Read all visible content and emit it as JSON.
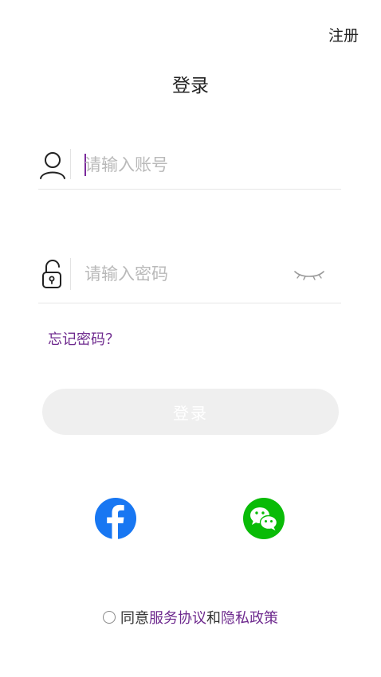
{
  "header": {
    "register_label": "注册",
    "title": "登录"
  },
  "account_field": {
    "placeholder": "请输入账号",
    "value": ""
  },
  "password_field": {
    "placeholder": "请输入密码",
    "value": ""
  },
  "forgot_password_label": "忘记密码？",
  "login_button_label": "登录",
  "social_login": {
    "facebook_icon": "facebook-icon",
    "wechat_icon": "wechat-icon"
  },
  "agreement": {
    "agree_prefix": "同意",
    "terms_link": "服务协议",
    "conjunction": "和",
    "privacy_link": "隐私政策"
  },
  "colors": {
    "accent": "#6e2a8e",
    "facebook": "#1877f2",
    "wechat": "#09bb07",
    "button_disabled": "#efefef"
  }
}
